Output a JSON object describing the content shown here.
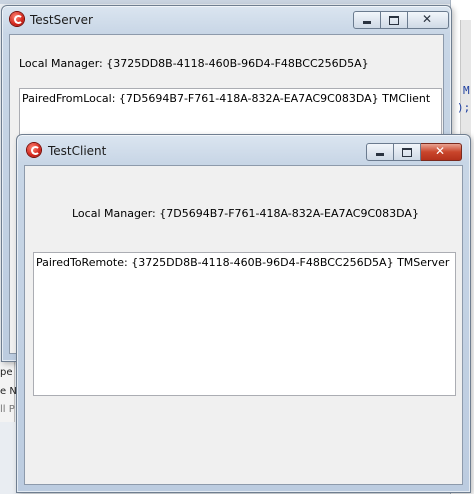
{
  "background": {
    "right_snippet_1": "M",
    "right_snippet_2": ");",
    "left_snippet_1": "pe",
    "left_snippet_2": "e N",
    "left_snippet_3": "ll P"
  },
  "server_window": {
    "title": "TestServer",
    "local_manager": "Local Manager: {3725DD8B-4118-460B-96D4-F48BCC256D5A}",
    "memo_text": "PairedFromLocal: {7D5694B7-F761-418A-832A-EA7AC9C083DA} TMClient"
  },
  "client_window": {
    "title": "TestClient",
    "local_manager": "Local Manager: {7D5694B7-F761-418A-832A-EA7AC9C083DA}",
    "memo_text": "PairedToRemote: {3725DD8B-4118-460B-96D4-F48BCC256D5A} TMServer"
  },
  "colors": {
    "close_button": "#c9452b",
    "title_bar": "#c8d6e6",
    "client_bg": "#f0f0f0"
  }
}
